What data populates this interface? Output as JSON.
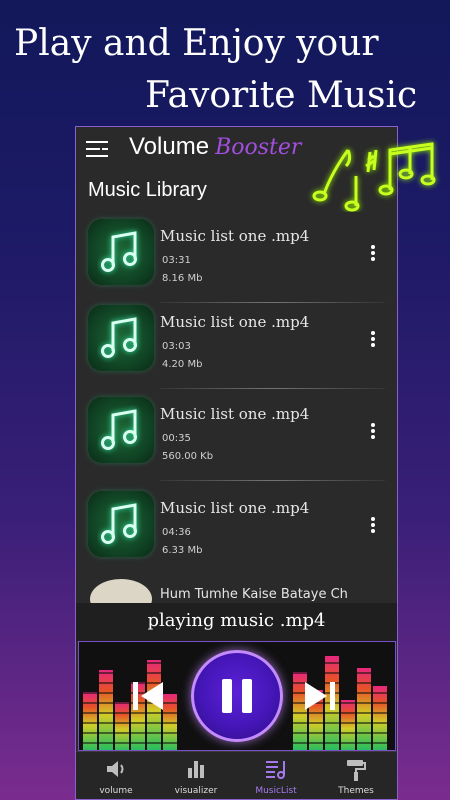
{
  "promo": {
    "line1": "Play and Enjoy your",
    "line2": "Favorite Music"
  },
  "app": {
    "title": "Volume",
    "title_accent": "Booster",
    "section_title": "Music Library"
  },
  "tracks": [
    {
      "name": "Music list one .mp4",
      "duration": "03:31",
      "size": "8.16 Mb"
    },
    {
      "name": "Music list one .mp4",
      "duration": "03:03",
      "size": "4.20 Mb"
    },
    {
      "name": "Music list one .mp4",
      "duration": "00:35",
      "size": "560.00 Kb"
    },
    {
      "name": "Music list one .mp4",
      "duration": "04:36",
      "size": "6.33 Mb"
    }
  ],
  "peek_track": {
    "name": "Hum Tumhe Kaise Bataye Ch"
  },
  "now_playing": "playing music .mp4",
  "player": {
    "prev_icon": "skip-previous-icon",
    "play_icon": "pause-icon",
    "next_icon": "skip-next-icon"
  },
  "nav": [
    {
      "label": "volume",
      "icon": "speaker-icon",
      "active": false
    },
    {
      "label": "visualizer",
      "icon": "bars-icon",
      "active": false
    },
    {
      "label": "MusicList",
      "icon": "playlist-icon",
      "active": true
    },
    {
      "label": "Themes",
      "icon": "paint-roller-icon",
      "active": false
    }
  ],
  "colors": {
    "accent": "#a24fe0",
    "track_thumb": "#1d6a38",
    "note_neon": "#c8ff1e"
  }
}
